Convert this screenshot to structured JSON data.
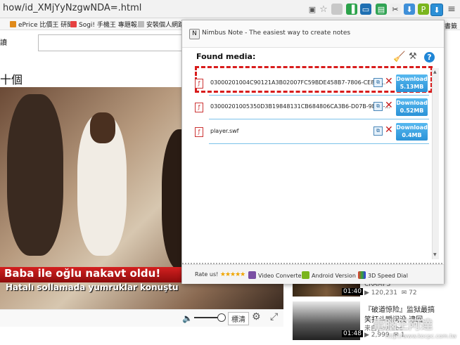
{
  "browser": {
    "url": "how/id_XMjYyNzgwNDA=.html",
    "bookmarks": [
      "ePrice 比價王 研聞",
      "Sogi! 手機王 專題報...",
      "安裝個人網路..."
    ]
  },
  "page": {
    "left_char": "讀",
    "heading_fragment": "十個",
    "news_line1": "Baba ile oğlu nakavt oldu!",
    "news_line2": "Hatalı sollamada yumruklar konuştu",
    "quality_label": "標清",
    "right_fragment": "書籤",
    "related": [
      {
        "duration": "01:40",
        "title": "CRAMPS",
        "views": "120,231",
        "comments": "72"
      },
      {
        "duration": "01:48",
        "title_line1": "『破道惊险』监狱最搞",
        "title_line2": "笑打斗瞬间没 逮回",
        "channel": "来自youtube",
        "views": "2,999",
        "comments": "1"
      }
    ],
    "watermark": "電腦王阿達",
    "watermark_url": "http://www.kocpc.com.tw"
  },
  "popup": {
    "title": "Nimbus Note - The easiest way to create notes",
    "found_label": "Found media:",
    "media": [
      {
        "name": "03000201004C90121A3B02007FC59BDE458B7-7806-CE8B-...",
        "download_label": "Download",
        "size": "5.13MB",
        "highlighted": true
      },
      {
        "name": "03000201005350D3B19848131CB684806CA3B6-D07B-9E8C-...",
        "download_label": "Download",
        "size": "0.52MB",
        "highlighted": false
      },
      {
        "name": "player.swf",
        "download_label": "Download",
        "size": "0.4MB",
        "highlighted": false
      }
    ],
    "footer": {
      "rate_label": "Rate us!",
      "stars": "★★★★★",
      "video_converter": "Video Converter",
      "android_version": "Android Version",
      "speed_dial": "3D Speed Dial"
    }
  },
  "colors": {
    "download_button": "#2b93d8",
    "highlight_border": "#d81c1c",
    "delete_icon": "#c61a1a"
  }
}
